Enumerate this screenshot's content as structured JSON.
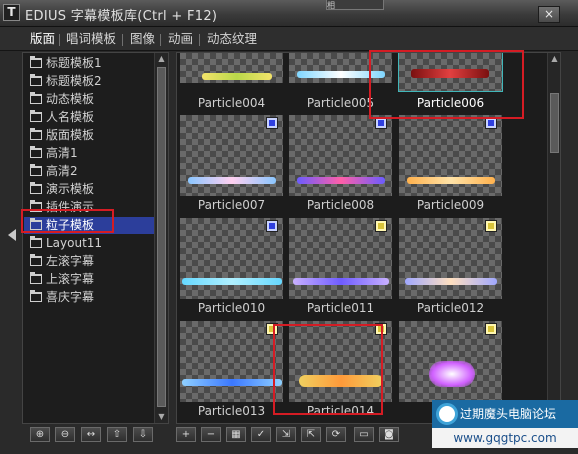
{
  "window": {
    "title": "EDIUS 字幕模板库(Ctrl + F12)",
    "background_window_text": "相",
    "close_label": "×",
    "app_icon_glyph": "T"
  },
  "tabs": [
    {
      "label": "版面",
      "active": true
    },
    {
      "label": "唱词模板",
      "active": false
    },
    {
      "label": "图像",
      "active": false
    },
    {
      "label": "动画",
      "active": false
    },
    {
      "label": "动态纹理",
      "active": false
    }
  ],
  "tree": {
    "items": [
      {
        "label": "标题模板1"
      },
      {
        "label": "标题模板2"
      },
      {
        "label": "动态模板"
      },
      {
        "label": "人名模板"
      },
      {
        "label": "版面模板"
      },
      {
        "label": "高清1"
      },
      {
        "label": "高清2"
      },
      {
        "label": "演示模板"
      },
      {
        "label": "插件演示"
      },
      {
        "label": "粒子模板",
        "selected": true
      },
      {
        "label": "Layout11"
      },
      {
        "label": "左滚字幕"
      },
      {
        "label": "上滚字幕"
      },
      {
        "label": "喜庆字幕"
      }
    ]
  },
  "grid": {
    "tiles": [
      {
        "label": "Particle004",
        "badge": "none",
        "colors": [
          "#f3e36a",
          "#b9d84a"
        ]
      },
      {
        "label": "Particle005",
        "badge": "none",
        "colors": [
          "#7fd6ff",
          "#ffffff"
        ]
      },
      {
        "label": "Particle006",
        "badge": "none",
        "selected": true,
        "colors": [
          "#e24040",
          "#7a1010"
        ]
      },
      {
        "label": "Particle007",
        "badge": "blue",
        "colors": [
          "#8ac6ff",
          "#ffd0f0"
        ]
      },
      {
        "label": "Particle008",
        "badge": "blue",
        "colors": [
          "#6b5cff",
          "#ff5fa8"
        ]
      },
      {
        "label": "Particle009",
        "badge": "blue",
        "colors": [
          "#ffb14d",
          "#ffe3a8"
        ]
      },
      {
        "label": "Particle010",
        "badge": "blue",
        "colors": [
          "#66d8ff",
          "#b0f0ff"
        ]
      },
      {
        "label": "Particle011",
        "badge": "yellow",
        "colors": [
          "#c8b0ff",
          "#6f5cff"
        ]
      },
      {
        "label": "Particle012",
        "badge": "yellow",
        "colors": [
          "#a0a8ff",
          "#ffe0c0"
        ]
      },
      {
        "label": "Particle013",
        "badge": "yellow",
        "colors": [
          "#8fd0ff",
          "#3b78ff"
        ]
      },
      {
        "label": "Particle014",
        "badge": "yellow",
        "colors": [
          "#f0d060",
          "#ff9a3a"
        ]
      },
      {
        "label": "",
        "badge": "yellow",
        "colors": [
          "#d060ff",
          "#ffffff"
        ]
      }
    ]
  },
  "toolbar_left": {
    "buttons": [
      {
        "icon": "new-folder-icon",
        "glyph": "⊕"
      },
      {
        "icon": "minus-folder-icon",
        "glyph": "⊖"
      },
      {
        "icon": "expand-icon",
        "glyph": "↔"
      },
      {
        "icon": "move-up-icon",
        "glyph": "⇧"
      },
      {
        "icon": "move-down-icon",
        "glyph": "⇩"
      }
    ]
  },
  "toolbar_right": {
    "buttons": [
      {
        "icon": "add-icon",
        "glyph": "+"
      },
      {
        "icon": "remove-icon",
        "glyph": "−"
      },
      {
        "icon": "grid-icon",
        "glyph": "▦"
      },
      {
        "icon": "check-icon",
        "glyph": "✓"
      },
      {
        "icon": "import-icon",
        "glyph": "⇲"
      },
      {
        "icon": "export-icon",
        "glyph": "⇱"
      },
      {
        "icon": "refresh-icon",
        "glyph": "⟳"
      },
      {
        "icon": "monitor-icon",
        "glyph": "▭"
      },
      {
        "icon": "preview-icon",
        "glyph": "◙"
      }
    ]
  },
  "watermark": {
    "text": "过期魔头电脑论坛",
    "url": "www.gqgtpc.com"
  },
  "colors": {
    "selection": "#2c3e9b",
    "highlight_box": "#d51c24",
    "selected_outline": "#41b6b9"
  }
}
